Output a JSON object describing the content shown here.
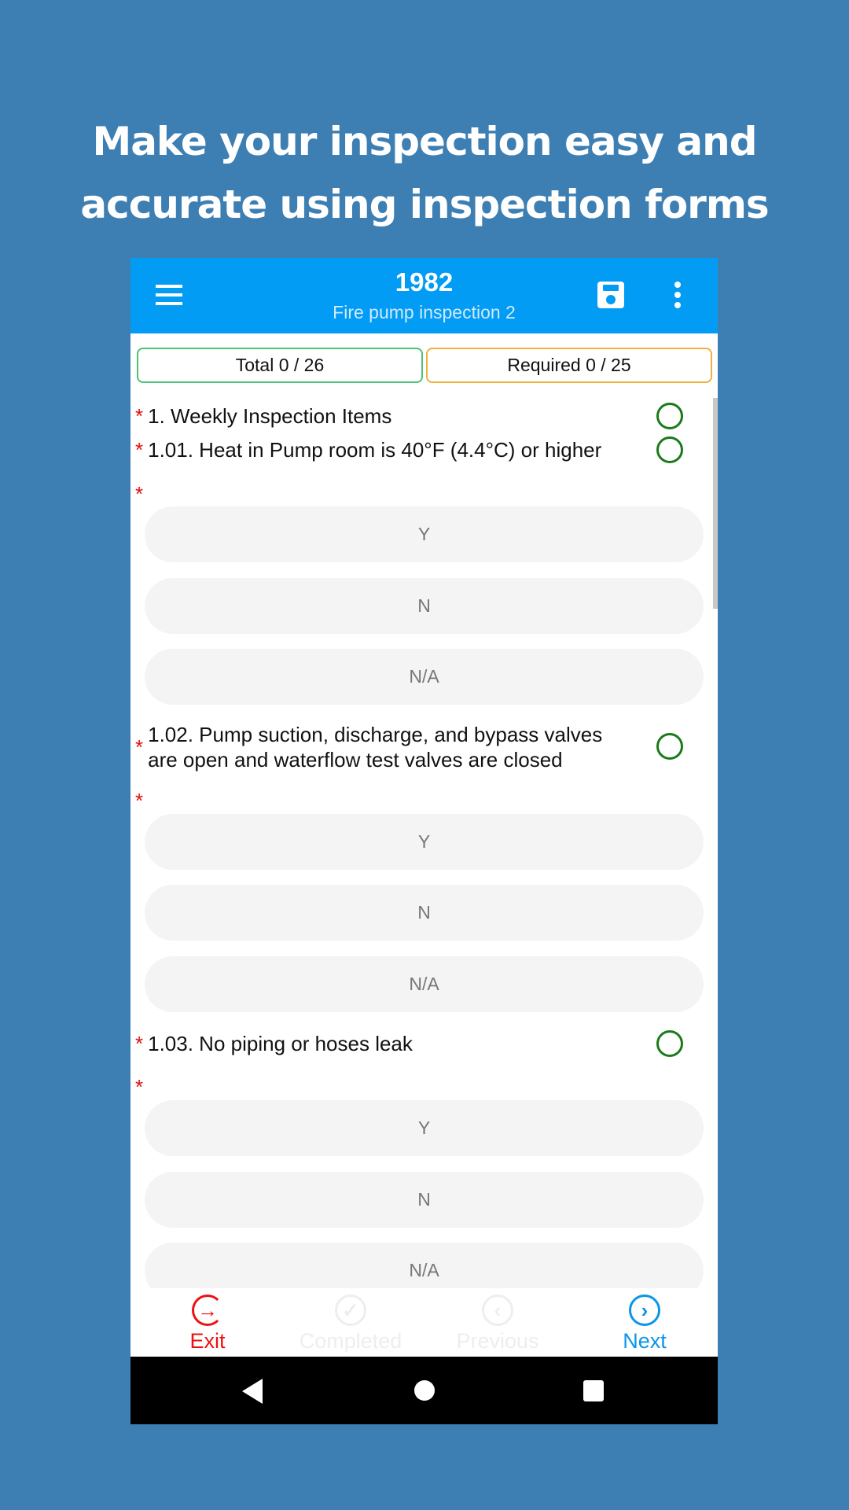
{
  "headline": {
    "line1": "Make your inspection easy and",
    "line2": "accurate using inspection forms"
  },
  "appbar": {
    "title": "1982",
    "subtitle": "Fire pump inspection 2",
    "menu_icon": "hamburger-icon",
    "save_icon": "floppy-disk-icon",
    "more_icon": "more-vert-icon"
  },
  "counters": {
    "total": "Total  0 / 26",
    "required": "Required  0 / 25",
    "total_color": "#4cc27a",
    "required_color": "#f0b040"
  },
  "section": {
    "title": "1. Weekly Inspection Items"
  },
  "questions": [
    {
      "label": "1.01. Heat in Pump room is 40°F (4.4°C) or higher",
      "options": [
        "Y",
        "N",
        "N/A"
      ]
    },
    {
      "label_line1": "1.02. Pump suction, discharge, and bypass valves",
      "label_line2": "are open and waterflow test valves are closed",
      "options": [
        "Y",
        "N",
        "N/A"
      ]
    },
    {
      "label": "1.03. No piping or hoses leak",
      "options": [
        "Y",
        "N",
        "N/A"
      ]
    }
  ],
  "required_mark": "*",
  "bottom": {
    "exit": "Exit",
    "completed": "Completed",
    "previous": "Previous",
    "next": "Next",
    "exit_color": "#ee1111",
    "next_color": "#0a96e8",
    "disabled_color": "#eeeeee"
  }
}
